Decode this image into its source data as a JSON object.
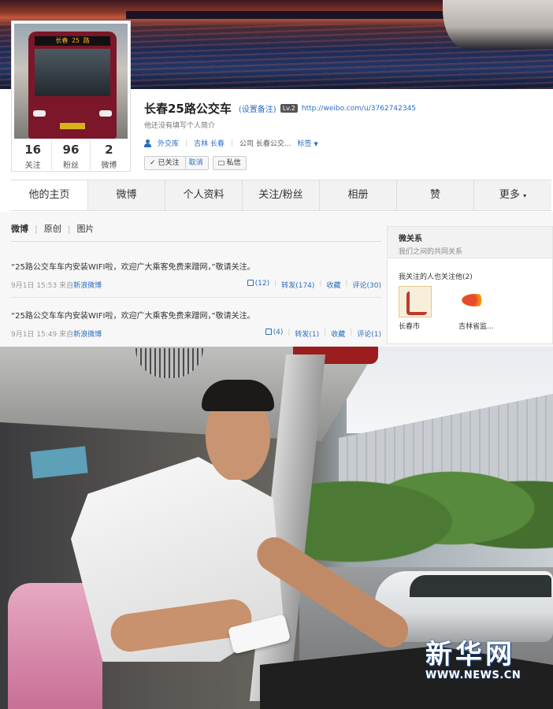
{
  "profile": {
    "bus_sign": "长春 25 路",
    "name": "长春25路公交车",
    "remark_link": "(设置备注)",
    "level": "Lv.2",
    "url": "http://weibo.com/u/3762742345",
    "bio": "他还没有填写个人简介",
    "location_1": "外交库",
    "location_2": "吉林 长春",
    "company": "公司 长春公交...",
    "tags": "标签",
    "stats": [
      {
        "num": "16",
        "label": "关注"
      },
      {
        "num": "96",
        "label": "粉丝"
      },
      {
        "num": "2",
        "label": "微博"
      }
    ],
    "follow_label": "已关注",
    "cancel_label": "取消",
    "message_label": "私信"
  },
  "nav": {
    "tabs": [
      "他的主页",
      "微博",
      "个人资料",
      "关注/粉丝",
      "相册",
      "赞",
      "更多"
    ]
  },
  "feed": {
    "tabs": [
      "微博",
      "原创",
      "图片"
    ],
    "posts": [
      {
        "text": "“25路公交车车内安装WIFI啦，欢迎广大乘客免费来蹭网，”敬请关注。",
        "time": "9月1日 15:53",
        "source_prefix": "来自",
        "source": "新浪微博",
        "likes": "(12)",
        "reposts": "转发(174)",
        "fav": "收藏",
        "comments": "评论(30)"
      },
      {
        "text": "“25路公交车车内安装WIFI啦，欢迎广大乘客免费来蹭网，”敬请关注。",
        "time": "9月1日 15:49",
        "source_prefix": "来自",
        "source": "新浪微博",
        "likes": "(4)",
        "reposts": "转发(1)",
        "fav": "收藏",
        "comments": "评论(1)"
      }
    ]
  },
  "sidebar": {
    "title": "微关系",
    "subtitle": "我们之间的共同关系",
    "common_label": "我关注的人也关注他(2)",
    "users": [
      {
        "name": "长春市"
      },
      {
        "name": "吉林省监..."
      }
    ]
  },
  "watermark": {
    "brand": "新华网",
    "url": "WWW.NEWS.CN"
  },
  "colors": {
    "link": "#2a6ec1",
    "bus_red": "#7b1728"
  }
}
